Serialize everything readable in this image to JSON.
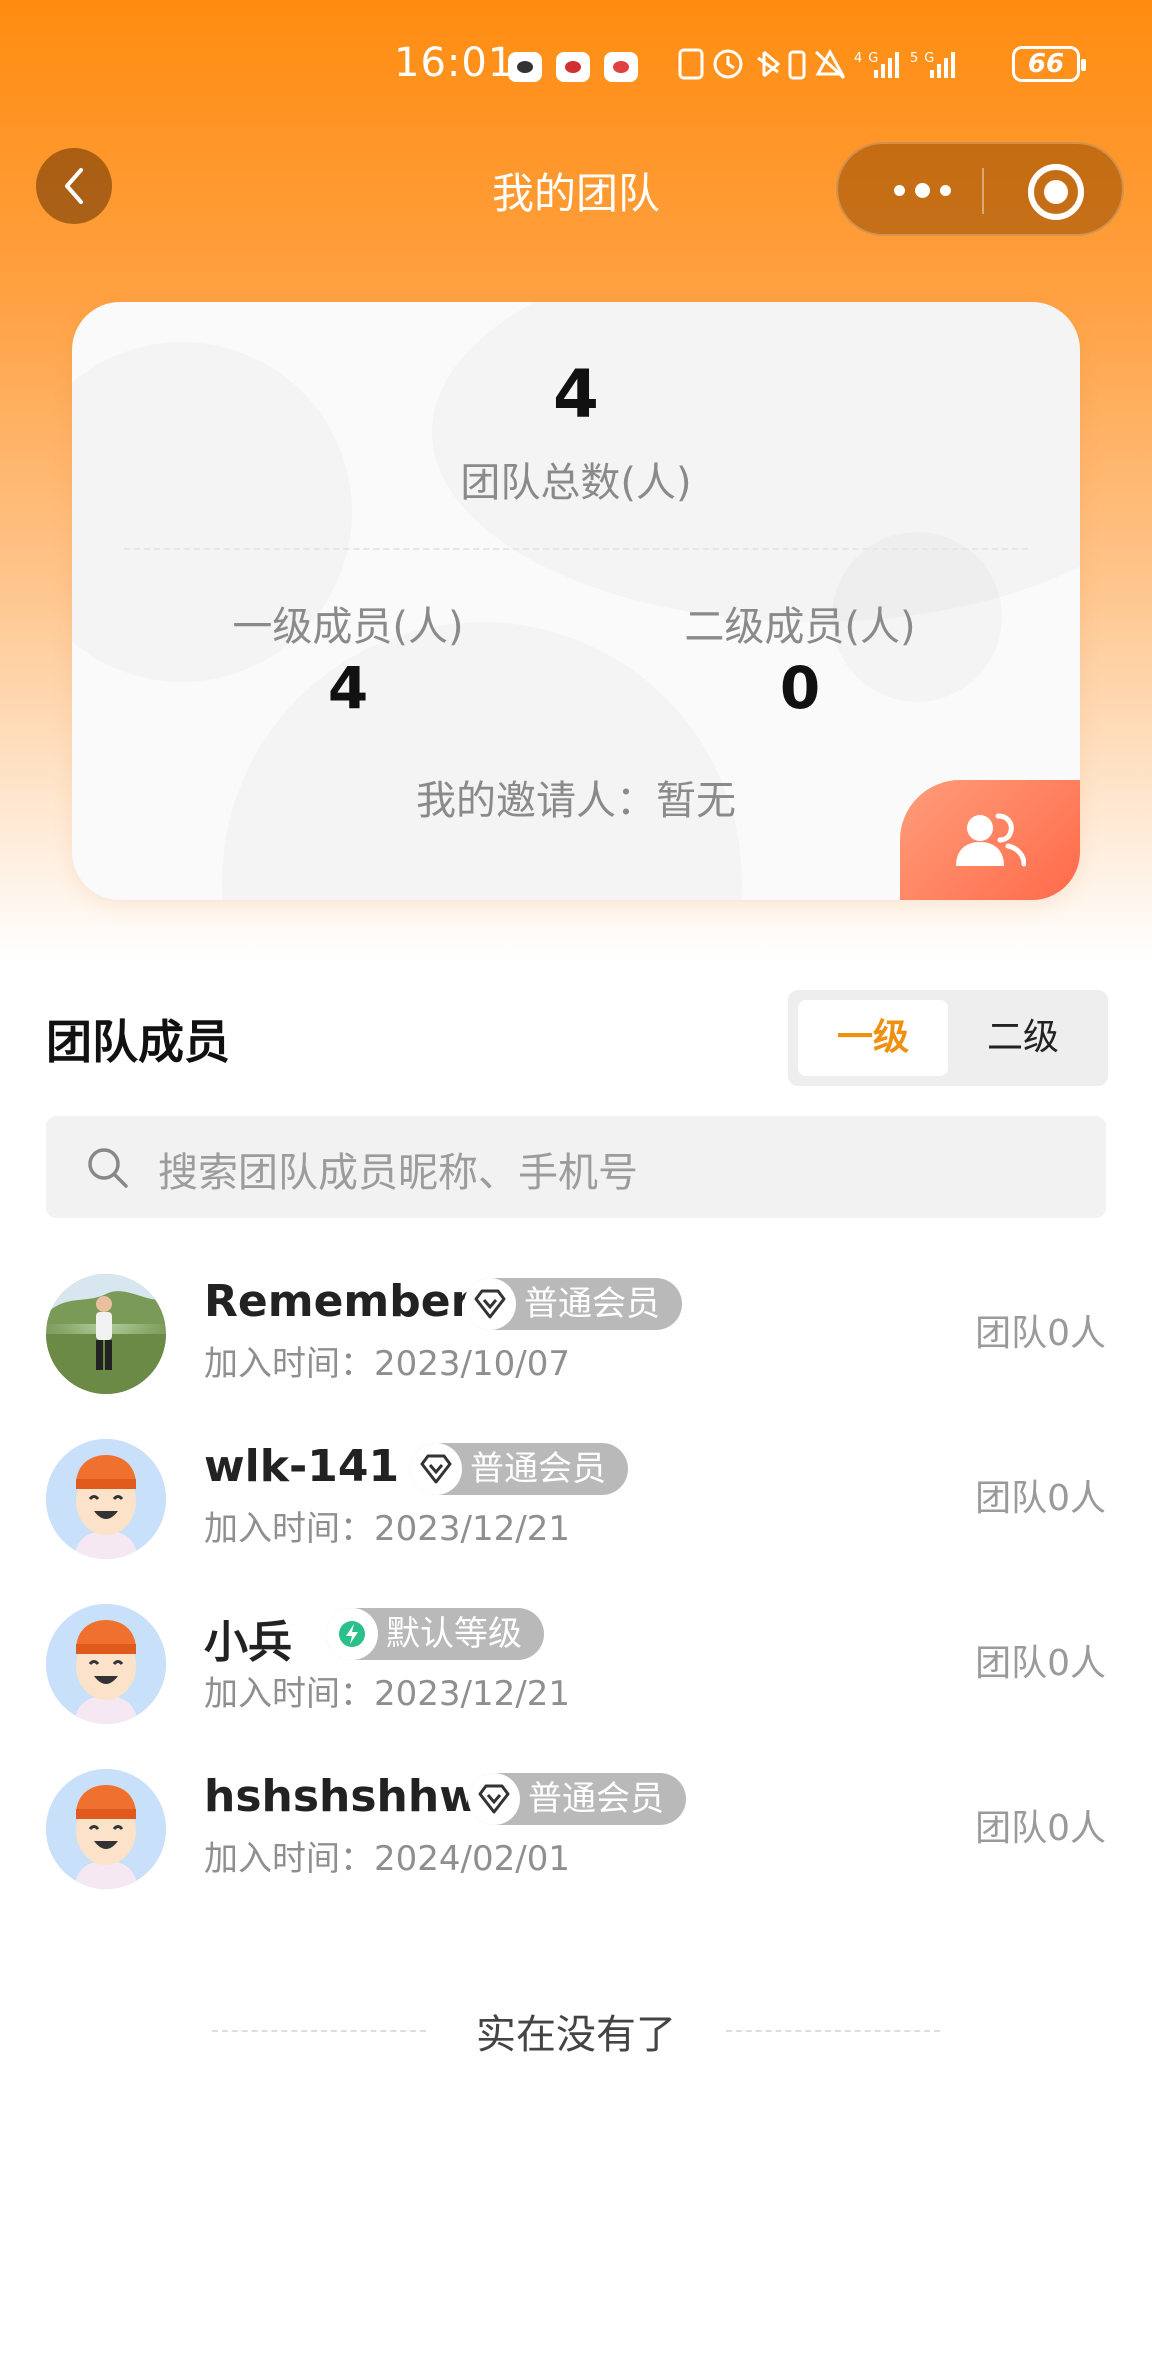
{
  "status_bar": {
    "time": "16:01",
    "battery": "66",
    "network_icons": [
      "nfc-icon",
      "alarm-icon",
      "bluetooth-icon",
      "vibrate-icon",
      "mute-icon",
      "4g-signal-icon",
      "5g-signal-icon"
    ]
  },
  "nav": {
    "title": "我的团队"
  },
  "summary": {
    "total_count": "4",
    "total_label": "团队总数(人)",
    "level1_label": "一级成员(人)",
    "level1_count": "4",
    "level2_label": "二级成员(人)",
    "level2_count": "0",
    "inviter_text": "我的邀请人：暂无"
  },
  "members_section": {
    "title": "团队成员",
    "tabs": [
      {
        "label": "一级",
        "active": true
      },
      {
        "label": "二级",
        "active": false
      }
    ],
    "search_placeholder": "搜索团队成员昵称、手机号"
  },
  "members": [
    {
      "name": "Remember",
      "badge": "普通会员",
      "badge_icon": "diamond-icon",
      "join": "加入时间：2023/10/07",
      "team": "团队0人",
      "avatar": "photo"
    },
    {
      "name": "wlk-141",
      "badge": "普通会员",
      "badge_icon": "diamond-icon",
      "join": "加入时间：2023/12/21",
      "team": "团队0人",
      "avatar": "cartoon"
    },
    {
      "name": "小兵",
      "badge": "默认等级",
      "badge_icon": "lightning-icon",
      "join": "加入时间：2023/12/21",
      "team": "团队0人",
      "avatar": "cartoon"
    },
    {
      "name": "hshshshhw",
      "badge": "普通会员",
      "badge_icon": "diamond-icon",
      "join": "加入时间：2024/02/01",
      "team": "团队0人",
      "avatar": "cartoon"
    }
  ],
  "footer": {
    "end_text": "实在没有了"
  },
  "colors": {
    "accent": "#f09010",
    "header_gradient_top": "#ff8c10",
    "badge_gray": "#b9b9b9",
    "card_badge": "#ff7a5a"
  }
}
